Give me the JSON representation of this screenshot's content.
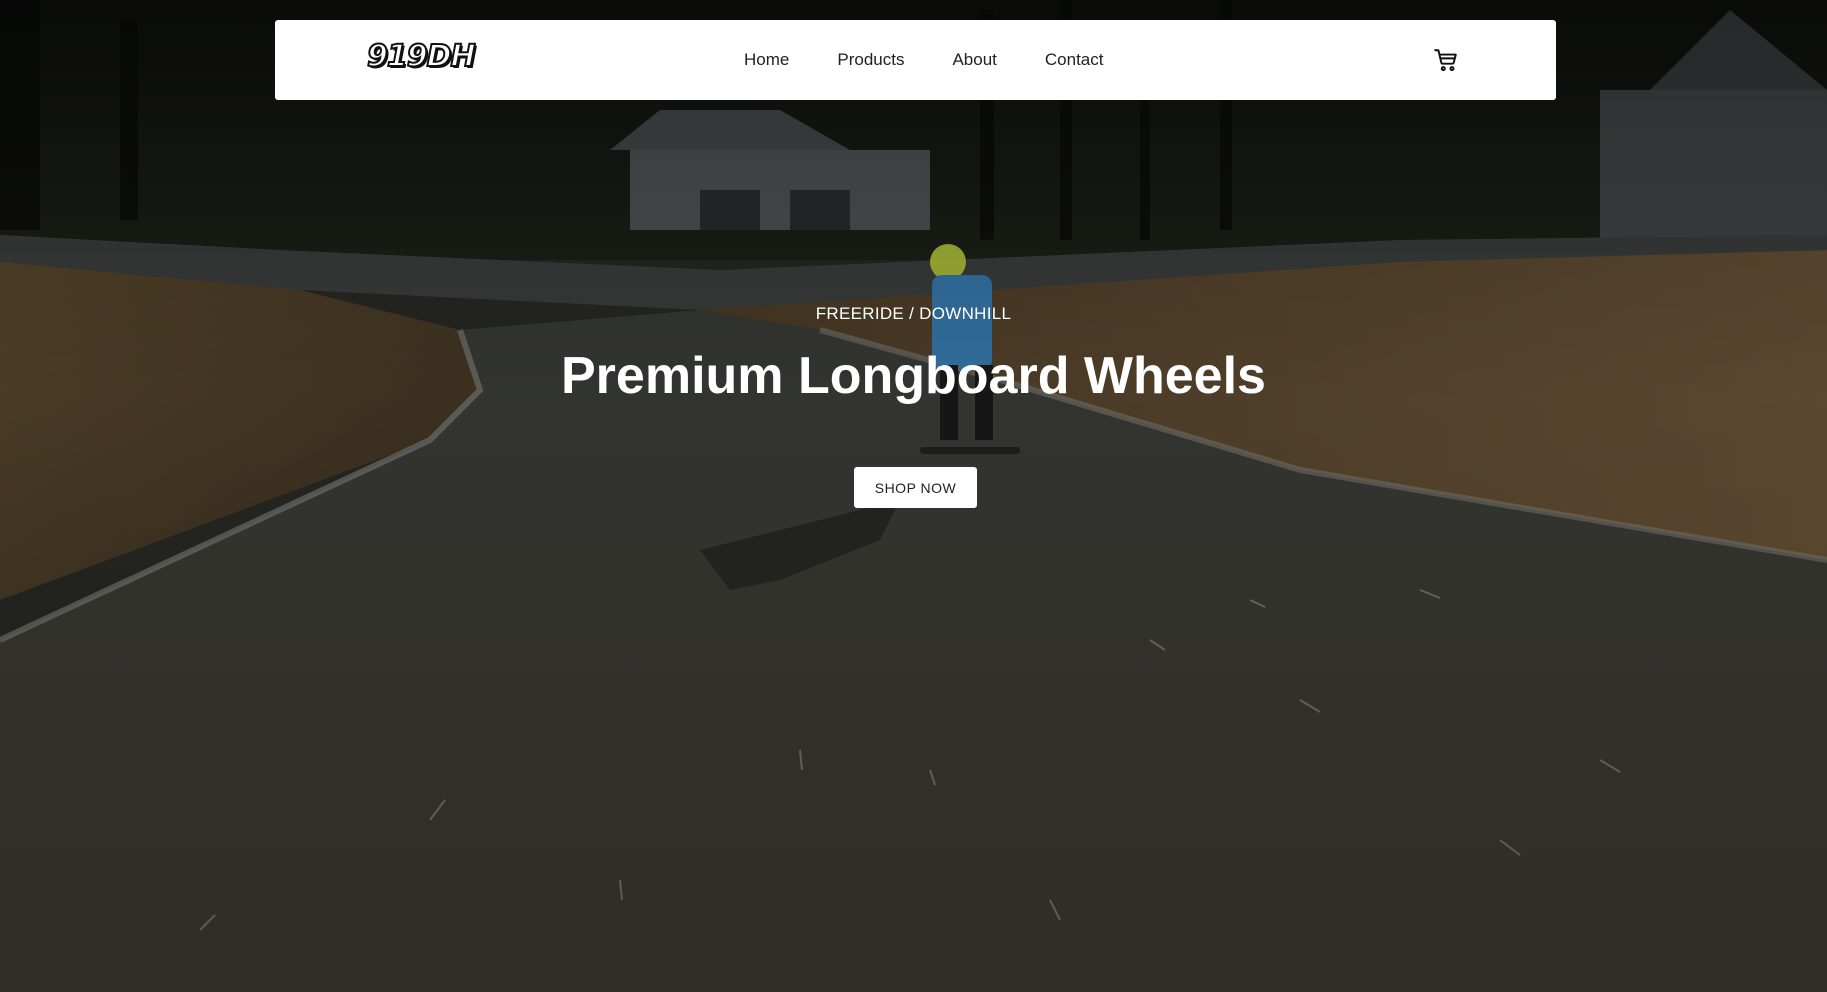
{
  "brand": {
    "logo_text": "919DH"
  },
  "nav": {
    "items": [
      {
        "label": "Home"
      },
      {
        "label": "Products"
      },
      {
        "label": "About"
      },
      {
        "label": "Contact"
      }
    ],
    "cart_icon": "cart-icon"
  },
  "hero": {
    "eyebrow": "FREERIDE / DOWNHILL",
    "headline": "Premium Longboard Wheels",
    "cta_label": "SHOP NOW",
    "background_icon": "longboard-rider-photo"
  },
  "colors": {
    "navbar_bg": "#ffffff",
    "text_dark": "#222222",
    "hero_text": "#ffffff"
  }
}
